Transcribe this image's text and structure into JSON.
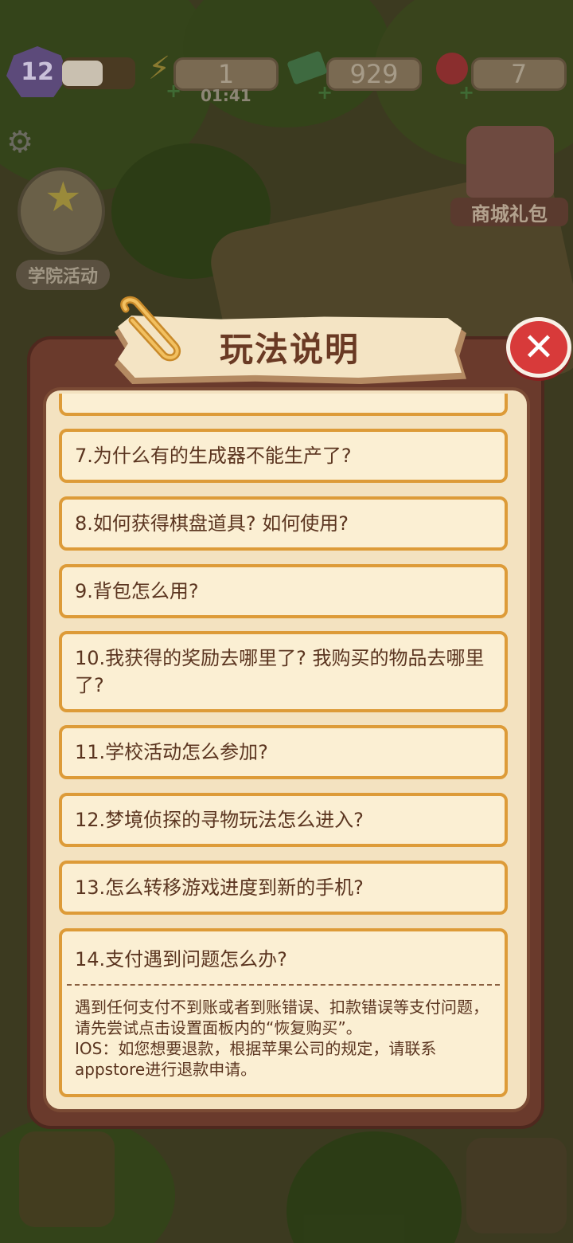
{
  "hud": {
    "level": "12",
    "xp_fraction": 0.55,
    "energy": "1",
    "energy_timer": "01:41",
    "cash": "929",
    "gems": "7"
  },
  "side": {
    "academy_label": "学院活动",
    "shop_label": "商城礼包"
  },
  "popup": {
    "title": "玩法说明",
    "items": [
      {
        "label": "7.为什么有的生成器不能生产了?"
      },
      {
        "label": "8.如何获得棋盘道具? 如何使用?"
      },
      {
        "label": "9.背包怎么用?"
      },
      {
        "label": "10.我获得的奖励去哪里了? 我购买的物品去哪里了?"
      },
      {
        "label": "11.学校活动怎么参加?"
      },
      {
        "label": "12.梦境侦探的寻物玩法怎么进入?"
      },
      {
        "label": "13.怎么转移游戏进度到新的手机?"
      }
    ],
    "open_item": {
      "label": "14.支付遇到问题怎么办?",
      "answer": "遇到任何支付不到账或者到账错误、扣款错误等支付问题，请先尝试点击设置面板内的“恢复购买”。\nIOS：如您想要退款，根据苹果公司的规定，请联系appstore进行退款申请。"
    }
  },
  "icons": {
    "level": "level-badge-icon",
    "energy": "lightning-icon",
    "cash": "cash-icon",
    "gem": "ruby-icon",
    "settings": "gear-icon",
    "close": "close-icon",
    "clip": "paperclip-icon"
  },
  "colors": {
    "panel": "#6a3a2c",
    "card_border": "#dd9b38",
    "card_bg": "#fbefd3",
    "text": "#5b3520",
    "close": "#d83a3a"
  }
}
